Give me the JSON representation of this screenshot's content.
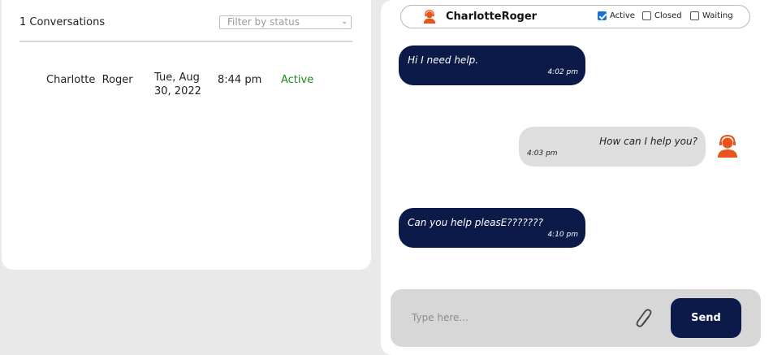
{
  "conversations": {
    "count_label": "1 Conversations",
    "filter_placeholder": "Filter by status",
    "rows": [
      {
        "name": "Charlotte  Roger",
        "date": "Tue, Aug 30, 2022",
        "time": "8:44 pm",
        "status": "Active"
      }
    ]
  },
  "chat": {
    "contact_name": "CharlotteRoger",
    "filters": [
      {
        "label": "Active",
        "checked": true
      },
      {
        "label": "Closed",
        "checked": false
      },
      {
        "label": "Waiting",
        "checked": false
      }
    ],
    "messages": [
      {
        "direction": "in",
        "text": "Hi I need help.",
        "time": "4:02 pm"
      },
      {
        "direction": "out",
        "text": "How can I help you?",
        "time": "4:03 pm"
      },
      {
        "direction": "in",
        "text": "Can you help pleasE???????",
        "time": "4:10 pm"
      }
    ],
    "input_placeholder": "Type here...",
    "send_label": "Send"
  },
  "colors": {
    "accent": "#0c1a4a",
    "status_active": "#1e8a1e",
    "avatar": "#e8541c"
  },
  "icons": {
    "header_avatar": "headset-user-icon",
    "agent_avatar": "headset-user-icon",
    "attach": "paperclip-icon",
    "filter_chevron": "chevron-down-icon"
  }
}
